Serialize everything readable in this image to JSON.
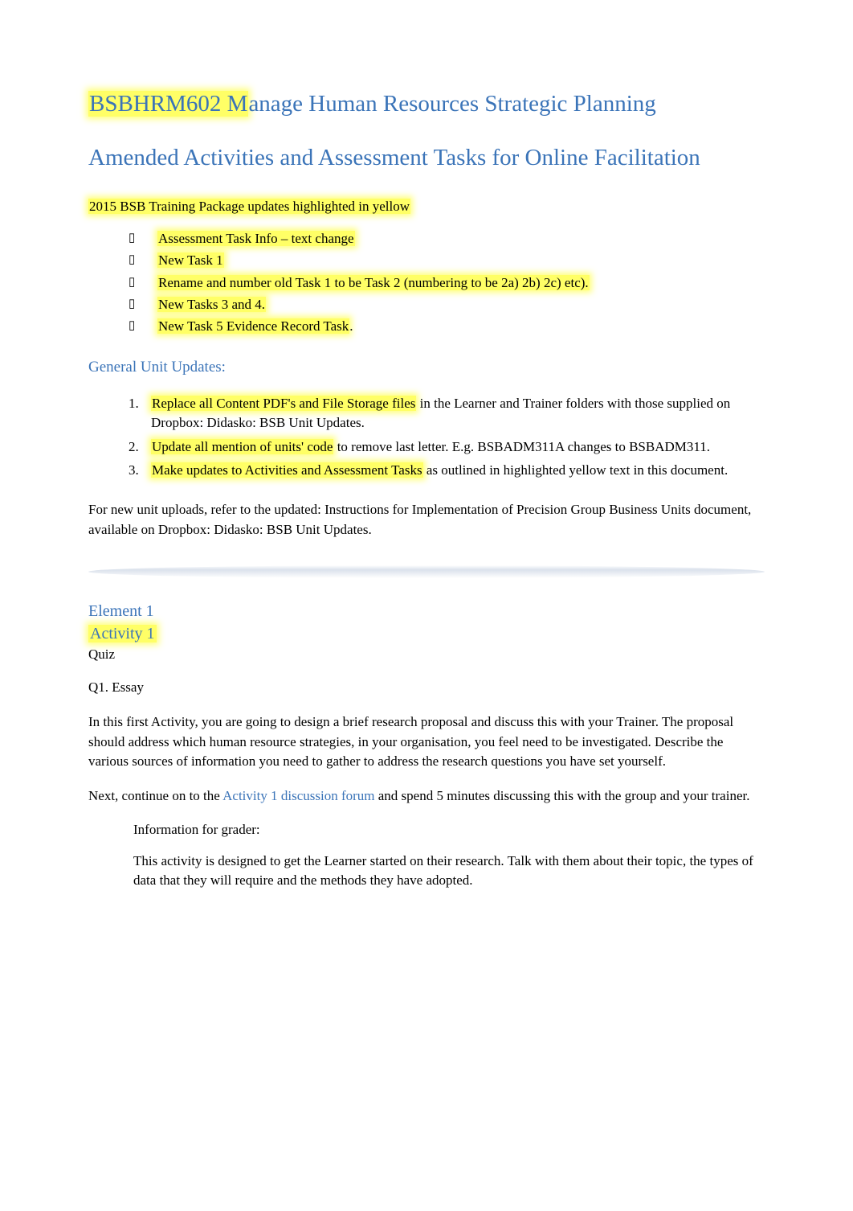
{
  "header": {
    "unit_code": "BSBHRM602",
    "unit_rest": "Manage Human Resources Strategic Planning",
    "subtitle": "Amended Activities and Assessment Tasks for Online Facilitation"
  },
  "intro_hl": "2015 BSB Training Package updates highlighted in yellow",
  "bullet_items": [
    "Assessment Task Info – text change",
    "New Task 1",
    "Rename and number old Task 1 to be Task 2 (numbering to be 2a) 2b) 2c) etc).",
    "New Tasks 3 and 4.",
    "New Task 5 Evidence Record Task"
  ],
  "bullet_trailing_dot": ".",
  "general_updates_heading": "General Unit Updates:",
  "general_updates": [
    {
      "hl": "Replace all Content PDF's and File Storage files",
      "rest": " in the Learner and Trainer folders with those supplied on ",
      "tail": "Dropbox: Didasko: BSB Unit Updates."
    },
    {
      "hl": "Update all mention of units' code",
      "rest": " to remove last letter. E.g. BSBADM311A changes to BSBADM311.",
      "tail": ""
    },
    {
      "hl": "Make updates to Activities and Assessment Tasks",
      "rest": " as outlined in highlighted yellow text in this document.",
      "tail": ""
    }
  ],
  "post_updates_para": "For new unit uploads, refer to the updated:   Instructions for Implementation of Precision Group Business Units document, available on Dropbox: Didasko: BSB Unit Updates.",
  "element1": {
    "label": "Element 1",
    "activity": "Activity 1",
    "quiz": "Quiz",
    "q1": "Q1. Essay",
    "para1": "In this first Activity, you are going to design a brief research proposal and discuss this with your Trainer. The proposal should address which human resource strategies, in your organisation, you feel need to be investigated. Describe the various sources of information you need to gather to address the research questions you have set yourself.",
    "para2_a": "Next, continue on to the  ",
    "para2_link": "Activity 1 discussion forum",
    "para2_b": " and spend 5 minutes discussing this with the group and your trainer.",
    "grader_head": "Information for grader:",
    "grader_body": "This activity is designed to get the Learner started on their research. Talk with them about their topic, the types of data that they will require and the methods they have adopted."
  }
}
